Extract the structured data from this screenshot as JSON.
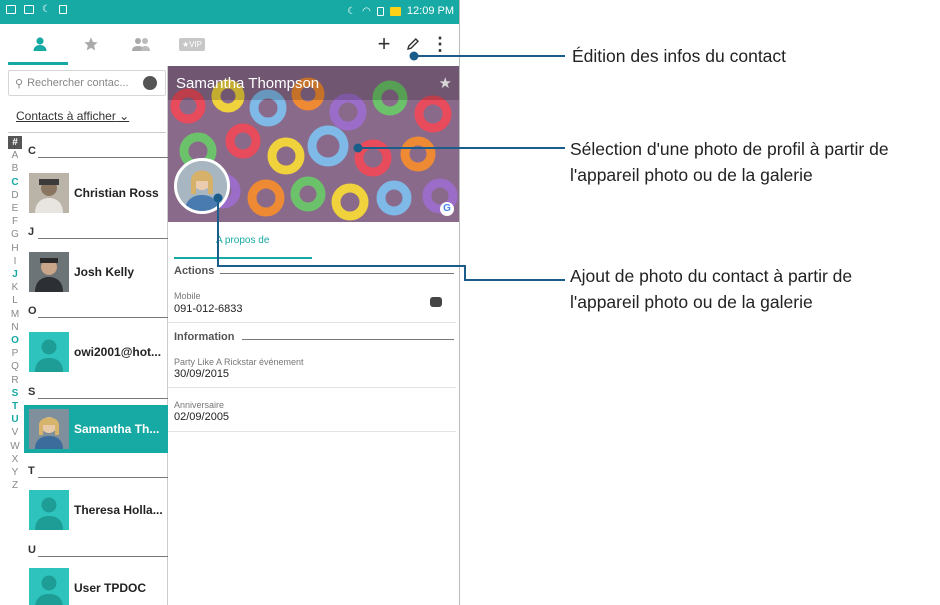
{
  "status_bar": {
    "time": "12:09 PM"
  },
  "contacts_search": {
    "placeholder": "Rechercher contac..."
  },
  "filter_label": "Contacts à afficher",
  "alphabet": [
    "#",
    "A",
    "B",
    "C",
    "D",
    "E",
    "F",
    "G",
    "H",
    "I",
    "J",
    "K",
    "L",
    "M",
    "N",
    "O",
    "P",
    "Q",
    "R",
    "S",
    "T",
    "U",
    "V",
    "W",
    "X",
    "Y",
    "Z"
  ],
  "sections": [
    "C",
    "J",
    "O",
    "S",
    "T",
    "U"
  ],
  "contacts": [
    {
      "name": "Christian Ross"
    },
    {
      "name": "Josh Kelly"
    },
    {
      "name": "owi2001@hot..."
    },
    {
      "name": "Samantha Th..."
    },
    {
      "name": "Theresa Holla..."
    },
    {
      "name": "User TPDOC"
    }
  ],
  "detail": {
    "name": "Samantha Thompson",
    "tab_about": "A propos de",
    "actions_header": "Actions",
    "mobile_label": "Mobile",
    "mobile_value": "091-012-6833",
    "info_header": "Information",
    "event_label": "Party Like A Rickstar événement",
    "event_value": "30/09/2015",
    "birthday_label": "Anniversaire",
    "birthday_value": "02/09/2005"
  },
  "toolbar": {
    "vip_label": "★VIP",
    "add": "+",
    "more": "⋮"
  },
  "annotations": {
    "edit": "Édition des infos du contact",
    "cover_line1": "Sélection d'une photo de profil à partir de",
    "cover_line2": "l'appareil photo ou de la galerie",
    "avatar_line1": "Ajout de photo du contact à partir de",
    "avatar_line2": "l'appareil photo ou de la galerie"
  },
  "colors": {
    "accent": "#17a9a3",
    "callout_line": "#1a5c8a"
  },
  "icons": [
    "person-icon",
    "star-icon",
    "group-icon",
    "vip-icon",
    "add-icon",
    "edit-icon",
    "more-icon",
    "search-icon",
    "mic-icon",
    "message-icon",
    "google-icon"
  ]
}
